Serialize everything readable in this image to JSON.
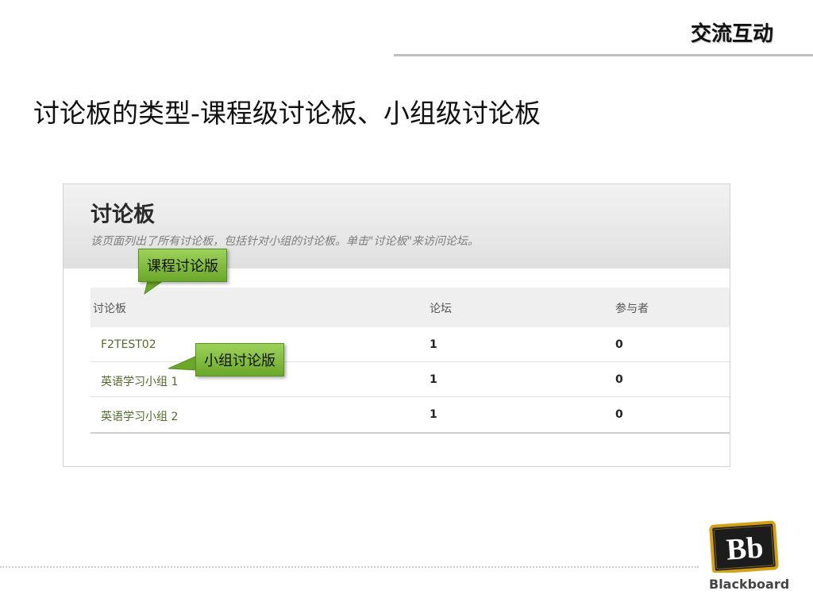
{
  "header": {
    "section_title": "交流互动"
  },
  "slide": {
    "subtitle": "讨论板的类型-课程级讨论板、小组级讨论板"
  },
  "screenshot": {
    "title": "讨论板",
    "description": "该页面列出了所有讨论板，包括针对小组的讨论板。单击\"讨论板\"来访问论坛。",
    "columns": [
      "讨论板",
      "论坛",
      "参与者"
    ],
    "rows": [
      {
        "name": "F2TEST02",
        "forums": "1",
        "participants": "0"
      },
      {
        "name": "英语学习小组 1",
        "forums": "1",
        "participants": "0"
      },
      {
        "name": "英语学习小组 2",
        "forums": "1",
        "participants": "0"
      }
    ]
  },
  "callouts": {
    "course": "课程讨论版",
    "group": "小组讨论版"
  },
  "logo": {
    "mark": "Bb",
    "wordmark": "Blackboard"
  },
  "colors": {
    "callout_green": "#7cb83a",
    "link_green": "#4f6b2a",
    "logo_gold": "#d4a017"
  }
}
